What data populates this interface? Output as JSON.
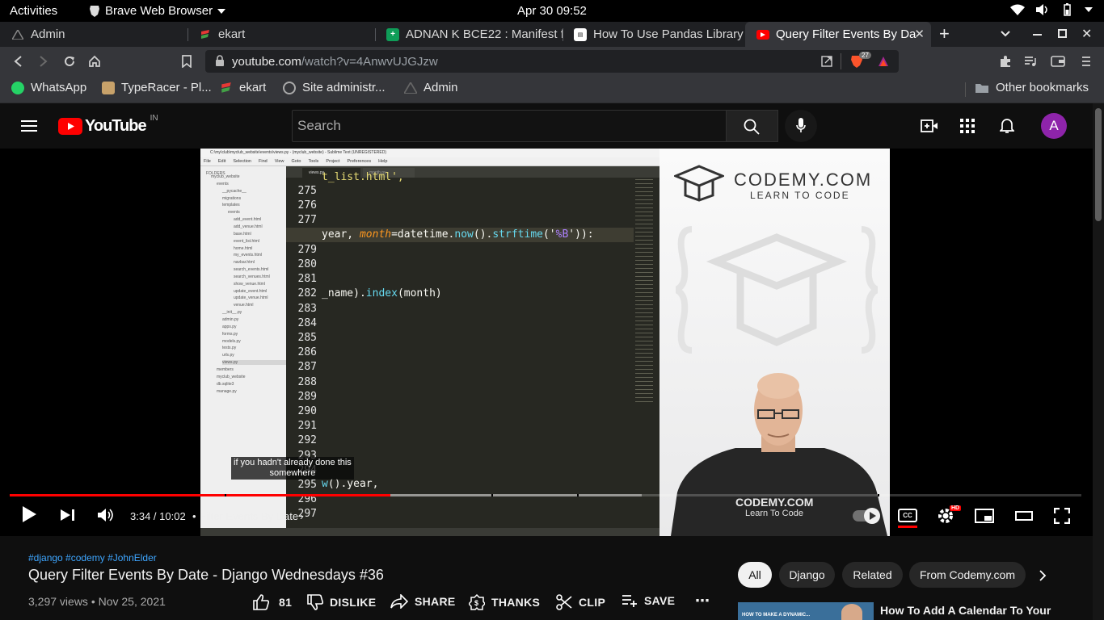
{
  "system": {
    "activities": "Activities",
    "app_name": "Brave Web Browser",
    "clock": "Apr 30  09:52"
  },
  "tabs": [
    {
      "title": "Admin"
    },
    {
      "title": "ekart"
    },
    {
      "title": "ADNAN K BCE22 : Manifest f"
    },
    {
      "title": "How To Use Pandas Library i"
    },
    {
      "title": "Query Filter Events By Da"
    }
  ],
  "address_bar": {
    "host": "youtube.com",
    "path": "/watch?v=4AnwvUJGJzw",
    "shield_count": "27"
  },
  "bookmarks": {
    "items": [
      {
        "label": "WhatsApp"
      },
      {
        "label": "TypeRacer - Pl..."
      },
      {
        "label": "ekart"
      },
      {
        "label": "Site administr..."
      },
      {
        "label": "Admin"
      }
    ],
    "other": "Other bookmarks"
  },
  "youtube": {
    "logo": "YouTube",
    "region": "IN",
    "search_placeholder": "Search",
    "avatar_letter": "A"
  },
  "video_frame": {
    "window_title": "C:\\my\\club\\myclub_website\\events\\views.py - (myclub_website) - Sublime Text (UNREGISTERED)",
    "menu": [
      "File",
      "Edit",
      "Selection",
      "Find",
      "View",
      "Goto",
      "Tools",
      "Project",
      "Preferences",
      "Help"
    ],
    "folders_label": "FOLDERS",
    "tab_active": "views.py",
    "tab_other": "month.py",
    "files": [
      "myclub_website",
      "events",
      "__pycache__",
      "migrations",
      "templates",
      "events",
      "add_event.html",
      "add_venue.html",
      "base.html",
      "event_list.html",
      "home.html",
      "my_events.html",
      "navbar.html",
      "search_events.html",
      "search_venues.html",
      "show_venue.html",
      "update_event.html",
      "update_venue.html",
      "venue.html",
      "__init__.py",
      "admin.py",
      "apps.py",
      "forms.py",
      "models.py",
      "tests.py",
      "urls.py",
      "views.py",
      "members",
      "myclub_website",
      "db.sqlite3",
      "manage.py"
    ],
    "line_numbers": [
      "275",
      "276",
      "277",
      "278",
      "279",
      "280",
      "281",
      "282",
      "283",
      "284",
      "285",
      "286",
      "287",
      "288",
      "289",
      "290",
      "291",
      "292",
      "293",
      "294",
      "295",
      "296",
      "297"
    ],
    "code": {
      "l274": "t_list.html',",
      "l278_a": "year, ",
      "l278_kw": "month",
      "l278_b": "=datetime.",
      "l278_fn1": "now",
      "l278_c": "().",
      "l278_fn2": "strftime",
      "l278_d": "('",
      "l278_str": "%B",
      "l278_e": "')):",
      "l282_a": "_name).",
      "l282_fn": "index",
      "l282_b": "(month)",
      "l295_a": "w",
      "l295_b": "().year,"
    },
    "codemy_brand": "CODEMY.COM",
    "codemy_tagline": "LEARN TO CODE",
    "shirt_line1": "CODEMY.COM",
    "shirt_line2": "Learn To Code"
  },
  "player": {
    "caption_line1": "if you hadn't already done this",
    "caption_line2": "somewhere",
    "time": "3:34 / 10:02",
    "chapter": "Filter Events By Date",
    "progress_played": 0.355,
    "progress_loaded": 0.59,
    "hd_badge": "HD"
  },
  "video_info": {
    "hashtags": "#django #codemy #JohnElder",
    "title": "Query Filter Events By Date - Django Wednesdays #36",
    "meta": "3,297 views • Nov 25, 2021",
    "likes": "81",
    "dislike": "DISLIKE",
    "share": "SHARE",
    "thanks": "THANKS",
    "clip": "CLIP",
    "save": "SAVE"
  },
  "chips": [
    {
      "label": "All"
    },
    {
      "label": "Django"
    },
    {
      "label": "Related"
    },
    {
      "label": "From Codemy.com"
    }
  ],
  "related": {
    "thumb_text": "HOW TO MAKE A DYNAMIC...",
    "title": "How To Add A Calendar To Your"
  },
  "colors": {
    "accent_red": "#ff0000",
    "link_blue": "#3ea6ff",
    "avatar_purple": "#8e24aa"
  }
}
